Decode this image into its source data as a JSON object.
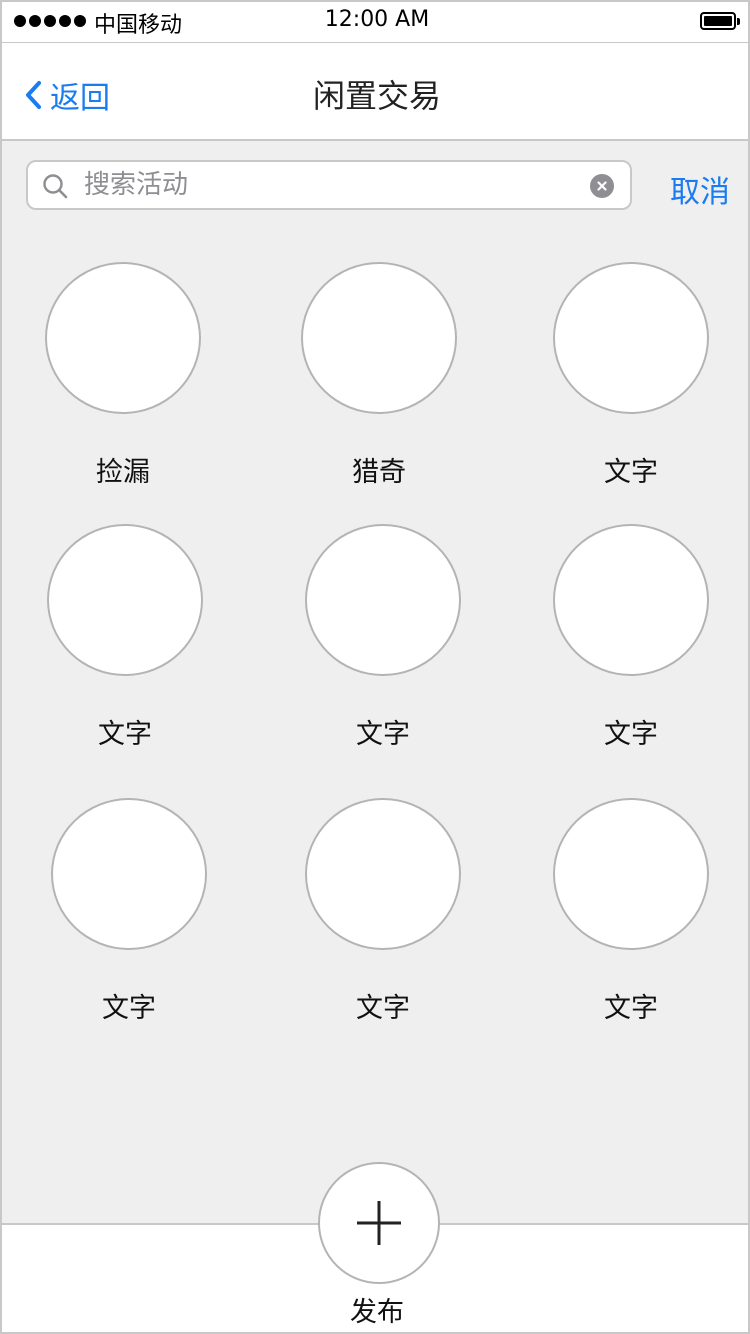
{
  "status_bar": {
    "carrier": "中国移动",
    "time": "12:00 AM",
    "signal_icon": "signal-dots-icon",
    "battery_icon": "battery-full-icon"
  },
  "nav": {
    "back_label": "返回",
    "title": "闲置交易",
    "accent_color": "#1a7cf0"
  },
  "search": {
    "placeholder": "搜索活动",
    "value": "",
    "cancel_label": "取消"
  },
  "categories": [
    {
      "label": "捡漏"
    },
    {
      "label": "猎奇"
    },
    {
      "label": "文字"
    },
    {
      "label": "文字"
    },
    {
      "label": "文字"
    },
    {
      "label": "文字"
    },
    {
      "label": "文字"
    },
    {
      "label": "文字"
    },
    {
      "label": "文字"
    }
  ],
  "tab_bar": {
    "publish_label": "发布",
    "publish_icon": "plus-icon"
  }
}
